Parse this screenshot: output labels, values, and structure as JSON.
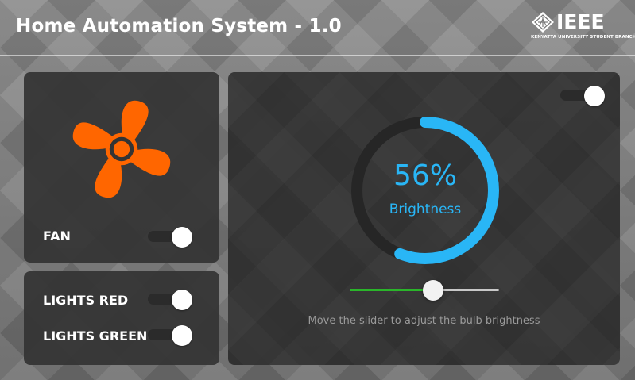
{
  "header": {
    "title": "Home Automation System - 1.0",
    "logo": {
      "text": "IEEE",
      "subtitle": "KENYATTA UNIVERSITY STUDENT BRANCH",
      "icon": "ieee-diamond-icon"
    }
  },
  "fan_card": {
    "icon": "fan-icon",
    "icon_color": "#ff6600",
    "label": "FAN",
    "toggle_on": true
  },
  "lights_card": {
    "items": [
      {
        "label": "LIGHTS RED",
        "toggle_on": true
      },
      {
        "label": "LIGHTS GREEN",
        "toggle_on": true
      }
    ]
  },
  "bulb_card": {
    "power_toggle_on": true,
    "gauge": {
      "percent": 56,
      "value_text": "56%",
      "label": "Brightness",
      "color": "#29b6f6",
      "track_color": "#262626"
    },
    "slider": {
      "value": 56,
      "min": 0,
      "max": 100,
      "fill_color": "#2ab52a"
    },
    "hint": "Move the slider to adjust the bulb brightness"
  }
}
